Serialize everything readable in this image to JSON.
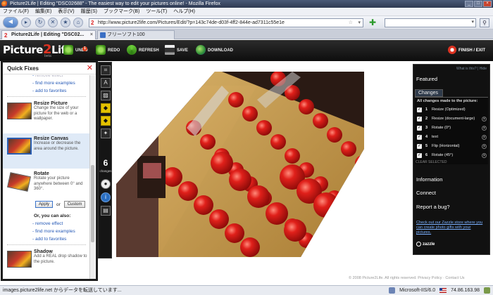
{
  "window": {
    "title": "Picture2Life | Editing \"DSC02688\" - The easiest way to edit your pictures online! - Mozilla Firefox"
  },
  "menu": [
    "ファイル(F)",
    "編集(E)",
    "表示(V)",
    "履歴(S)",
    "ブックマーク(B)",
    "ツール(T)",
    "ヘルプ(H)"
  ],
  "nav": {
    "url": "http://www.picture2life.com/Pictures/Edit/?p=143c74de-d03f-4ff2-844e-ad7311c55e1e"
  },
  "tabs": [
    {
      "label": "Picture2Life | Editing \"DSC02...",
      "active": true
    },
    {
      "label": "フリーソフト100",
      "active": false
    }
  ],
  "app": {
    "logo_prefix": "Picture",
    "logo_two": "2",
    "logo_suffix": "Life",
    "logo_sub": "beta",
    "undo_badge": "1",
    "buttons": {
      "undo": "UNDO",
      "redo": "REDO",
      "refresh": "REFRESH",
      "save": "SAVE",
      "download": "DOWNLOAD",
      "finish": "FINISH / EXIT"
    }
  },
  "quick_fixes": {
    "title": "Quick Fixes",
    "cut_link": "remove effect",
    "top_links": [
      "find more examples",
      "add to favorites"
    ],
    "fixes": [
      {
        "title": "Resize Picture",
        "desc": "Change the size of your picture for the web or a wallpaper."
      },
      {
        "title": "Resize Canvas",
        "desc": "Increase or decrease the area around the picture."
      },
      {
        "title": "Rotate",
        "desc": "Rotate your picture anywhere between 0° and 360°."
      },
      {
        "title": "Shadow",
        "desc": "Add a REAL drop shadow to the picture."
      }
    ],
    "apply_label": "Apply",
    "or_label": "or",
    "custom_label": "Custom",
    "also_title": "Or, you can also:",
    "also_links": [
      "remove effect",
      "find more examples",
      "add to favorites"
    ]
  },
  "toolstrip": {
    "changes_count": "6",
    "changes_label": "changes"
  },
  "right_panel": {
    "top_links": "What is this? | Hide",
    "featured": "Featured",
    "changes_tab": "Changes",
    "changes_sub": "All changes made to the picture:",
    "changes": [
      {
        "num": "1",
        "label": "Resize (Optimized)",
        "toggle": false
      },
      {
        "num": "2",
        "label": "Resize (document-large)",
        "toggle": true
      },
      {
        "num": "3",
        "label": "Rotate (0°)",
        "toggle": true
      },
      {
        "num": "4",
        "label": "text",
        "toggle": true
      },
      {
        "num": "5",
        "label": "Flip (Horizontal)",
        "toggle": true
      },
      {
        "num": "6",
        "label": "Rotate (45°)",
        "toggle": true
      }
    ],
    "clear": "CLEAR SELECTED",
    "information": "Information",
    "connect": "Connect",
    "report": "Report a bug?",
    "zazzle_text": "Check out our Zazzle store where you can create photo gifts with your pictures.",
    "zazzle_logo": "zazzle"
  },
  "footer": "© 2008 Picture2Life. All rights reserved. Privacy Policy · Contact Us",
  "status": {
    "left": "images.picture2life.net からデータを転送しています...",
    "server": "Microsoft-IIS/6.0",
    "ip": "74.86.163.98"
  },
  "colors": {
    "app_header": "#111111",
    "accent_red": "#d32222",
    "link_blue": "#2559b6"
  }
}
